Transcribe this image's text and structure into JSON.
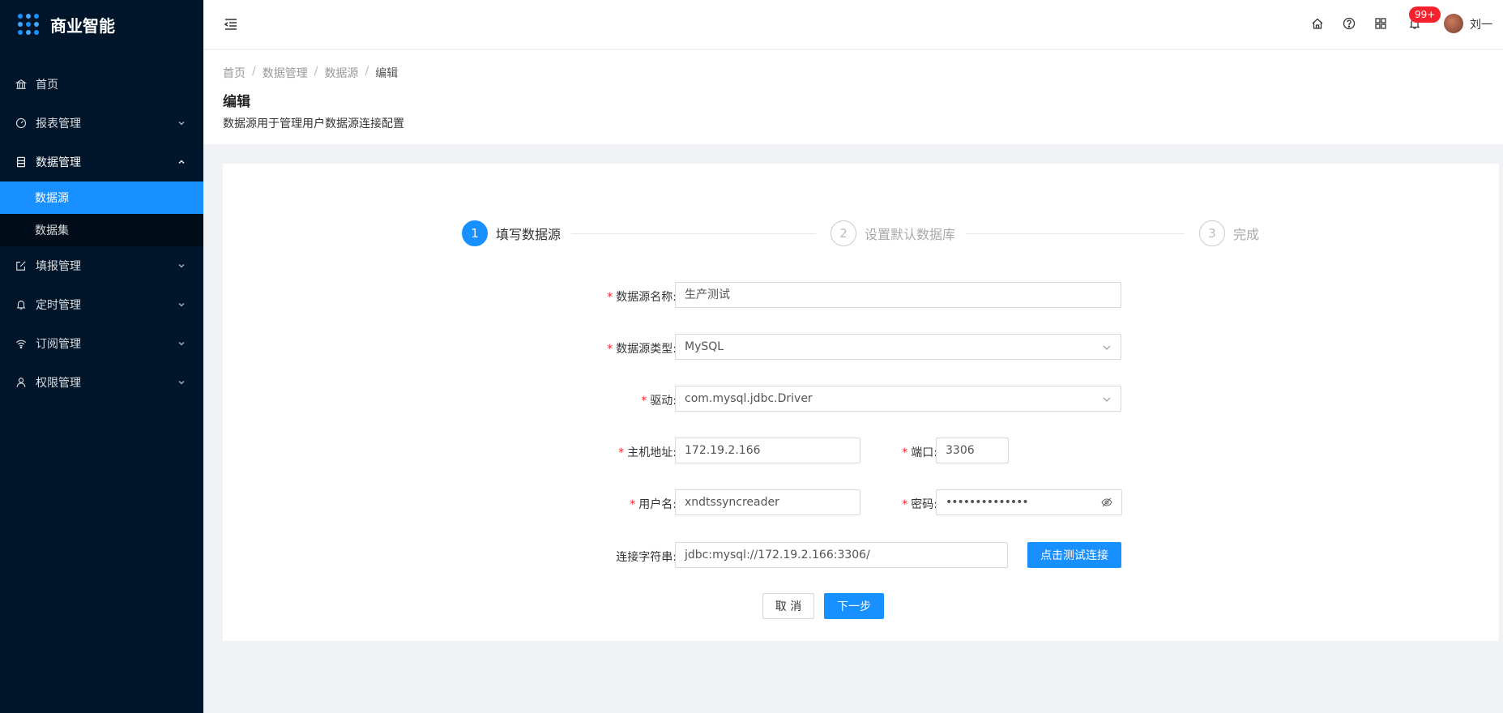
{
  "app": {
    "title": "商业智能"
  },
  "sidebar": {
    "items": [
      {
        "label": "首页",
        "icon": "bank-icon"
      },
      {
        "label": "报表管理",
        "icon": "dashboard-icon"
      },
      {
        "label": "数据管理",
        "icon": "database-icon"
      },
      {
        "label": "填报管理",
        "icon": "edit-icon"
      },
      {
        "label": "定时管理",
        "icon": "bell-icon"
      },
      {
        "label": "订阅管理",
        "icon": "wifi-icon"
      },
      {
        "label": "权限管理",
        "icon": "user-icon"
      }
    ],
    "sub_items": [
      {
        "label": "数据源",
        "active": true
      },
      {
        "label": "数据集",
        "active": false
      }
    ]
  },
  "header": {
    "notification_count": "99+",
    "username": "刘一"
  },
  "breadcrumb": [
    "首页",
    "数据管理",
    "数据源",
    "编辑"
  ],
  "page": {
    "title": "编辑",
    "description": "数据源用于管理用户数据源连接配置"
  },
  "steps": [
    {
      "num": "1",
      "label": "填写数据源"
    },
    {
      "num": "2",
      "label": "设置默认数据库"
    },
    {
      "num": "3",
      "label": "完成"
    }
  ],
  "form": {
    "name": {
      "label": "数据源名称:",
      "value": "生产测试"
    },
    "type": {
      "label": "数据源类型:",
      "value": "MySQL"
    },
    "driver": {
      "label": "驱动:",
      "value": "com.mysql.jdbc.Driver"
    },
    "host": {
      "label": "主机地址:",
      "value": "172.19.2.166"
    },
    "port": {
      "label": "端口:",
      "value": "3306"
    },
    "username": {
      "label": "用户名:",
      "value": "xndtssyncreader"
    },
    "password": {
      "label": "密码:",
      "value": "••••••••••••••"
    },
    "conn": {
      "label": "连接字符串:",
      "value": "jdbc:mysql://172.19.2.166:3306/"
    },
    "test_button": "点击测试连接",
    "cancel_button": "取 消",
    "next_button": "下一步"
  },
  "colors": {
    "primary": "#1890ff",
    "sidebar_bg": "#001529",
    "required": "#f5222d"
  }
}
